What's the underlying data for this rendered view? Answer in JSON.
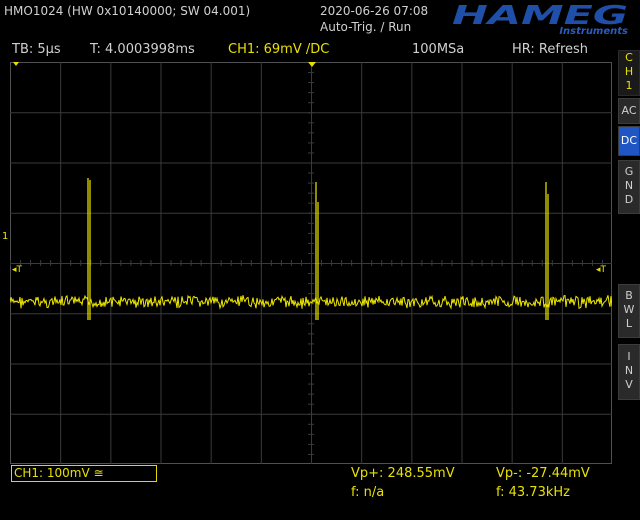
{
  "header": {
    "device": "HMO1024 (HW 0x10140000; SW 04.001)",
    "datetime": "2020-06-26 07:08",
    "trigger_mode": "Auto-Trig. / Run",
    "logo_text": "HAMEG",
    "logo_sub": "Instruments"
  },
  "statusbar": {
    "timebase": "TB: 5µs",
    "trigger_time": "T: 4.0003998ms",
    "channel_trigger": "CH1: 69mV /DC",
    "sample_rate": "100MSa",
    "horizontal_res": "HR: Refresh"
  },
  "side_menu": {
    "channel": [
      "C",
      "H",
      "1"
    ],
    "ac": "AC",
    "dc": "DC",
    "gnd": [
      "G",
      "N",
      "D"
    ],
    "bwl": [
      "B",
      "W",
      "L"
    ],
    "inv": [
      "I",
      "N",
      "V"
    ]
  },
  "markers": {
    "trigger_left": "◂T",
    "trigger_right": "◂T",
    "ground": "1"
  },
  "footer": {
    "ch1_scale": "CH1: 100mV ≅",
    "vp_plus": "Vp+: 248.55mV",
    "vp_minus": "Vp-: -27.44mV",
    "freq_left": "f: n/a",
    "freq_right": "f: 43.73kHz"
  },
  "colors": {
    "trace": "#f0e800",
    "grid": "#3a3a3a",
    "active_button": "#1f56c4"
  }
}
